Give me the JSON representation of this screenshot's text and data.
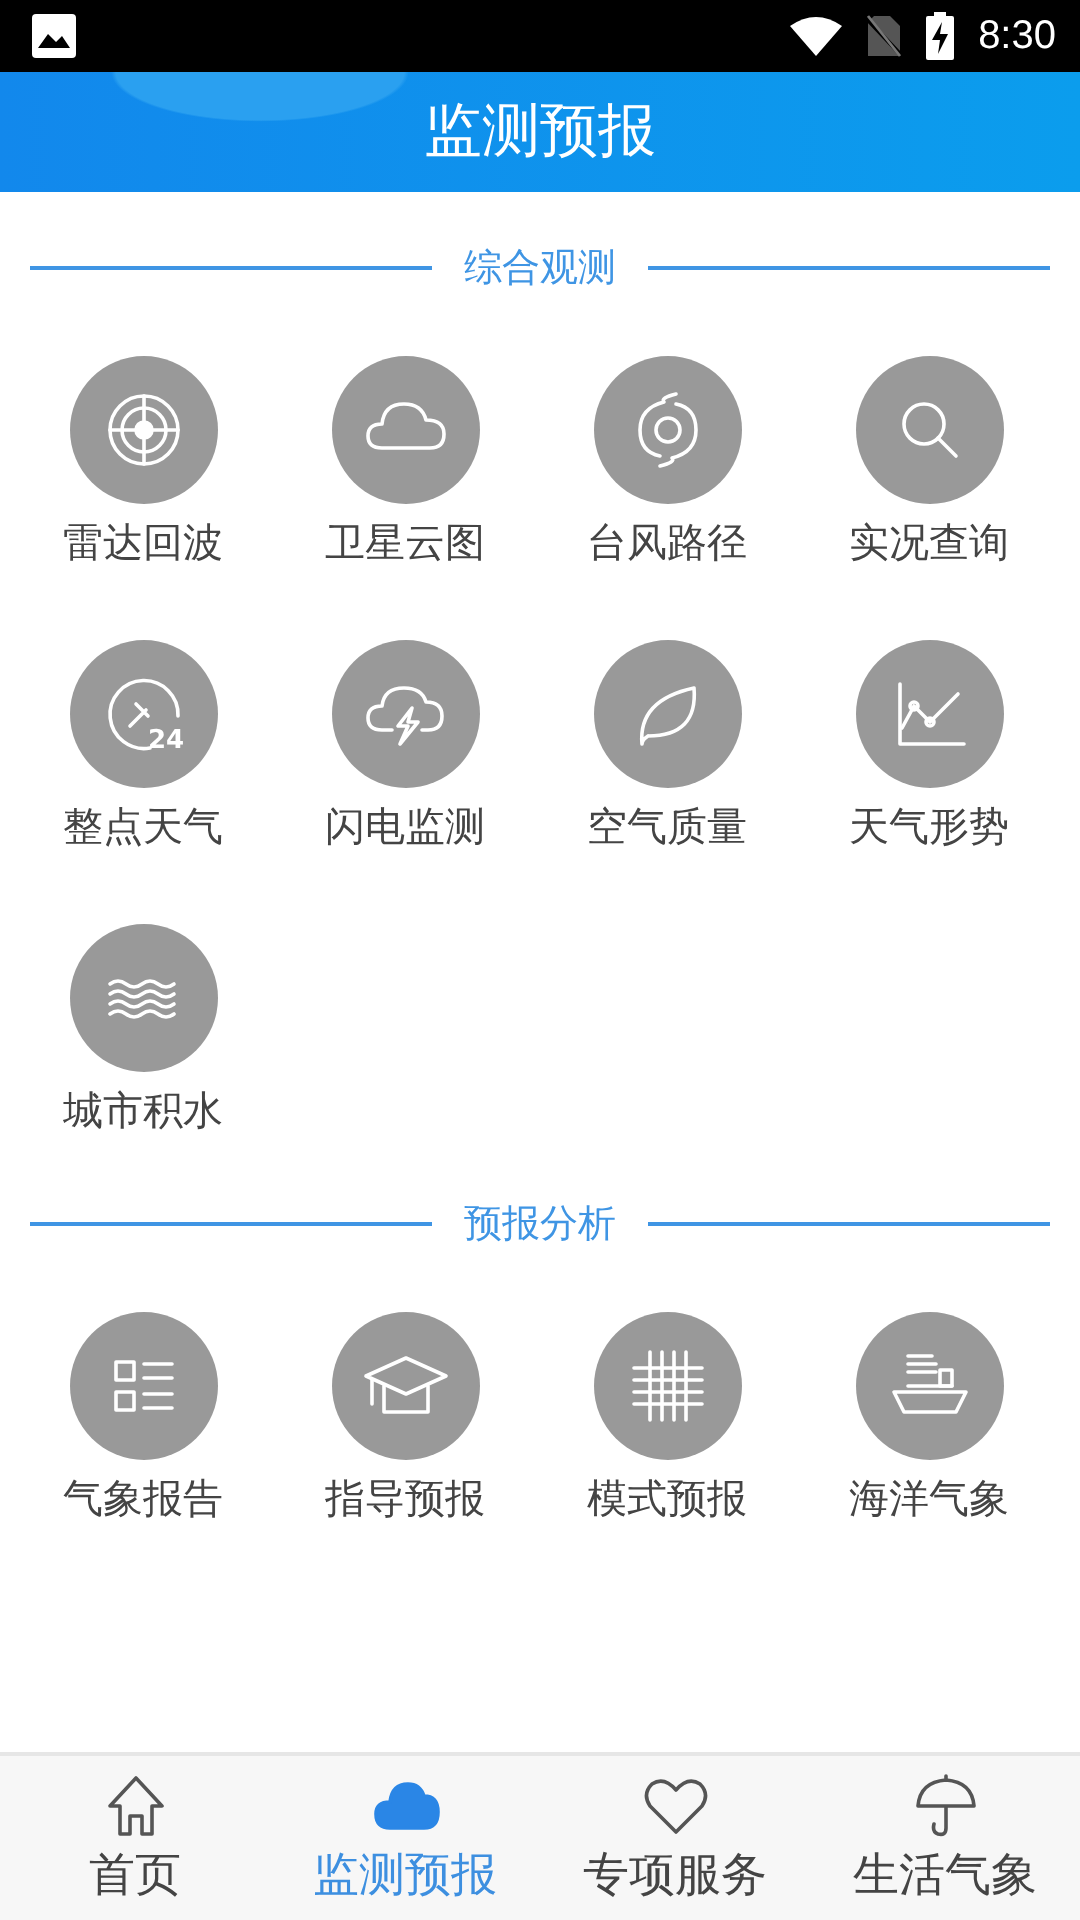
{
  "status_bar": {
    "time": "8:30"
  },
  "header": {
    "title": "监测预报"
  },
  "sections": [
    {
      "title": "综合观测",
      "items": [
        {
          "label": "雷达回波"
        },
        {
          "label": "卫星云图"
        },
        {
          "label": "台风路径"
        },
        {
          "label": "实况查询"
        },
        {
          "label": "整点天气",
          "icon_text": "24"
        },
        {
          "label": "闪电监测"
        },
        {
          "label": "空气质量"
        },
        {
          "label": "天气形势"
        },
        {
          "label": "城市积水"
        }
      ]
    },
    {
      "title": "预报分析",
      "items": [
        {
          "label": "气象报告"
        },
        {
          "label": "指导预报"
        },
        {
          "label": "模式预报"
        },
        {
          "label": "海洋气象"
        }
      ]
    }
  ],
  "bottom_nav": [
    {
      "label": "首页",
      "selected": false
    },
    {
      "label": "监测预报",
      "selected": true
    },
    {
      "label": "专项服务",
      "selected": false
    },
    {
      "label": "生活气象",
      "selected": false
    }
  ]
}
